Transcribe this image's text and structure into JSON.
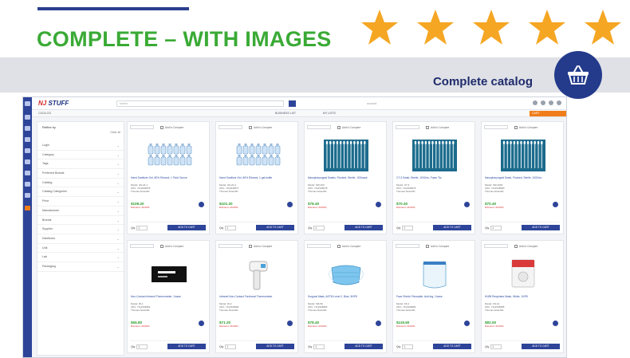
{
  "promo": {
    "headline": "COMPLETE – WITH IMAGES",
    "banner_text": "Complete catalog",
    "rating_stars": 5,
    "colors": {
      "headline": "#3aaa35",
      "star": "#f5a623",
      "accent": "#243b8c"
    },
    "icons": [
      "star-icon",
      "basket-icon"
    ]
  },
  "app": {
    "logo_text": "NJ",
    "logo_text_2": "STUFF",
    "search_placeholder": "search",
    "account_text": "account",
    "breadcrumb": "CATALOG",
    "subnav": [
      "BUSINESS LIST",
      "MY LISTS"
    ],
    "cart_label": "CART",
    "filters": {
      "title": "Refine by",
      "clear_label": "Clear all",
      "items": [
        "Login",
        "Category",
        "Tags",
        "Preferred Brands",
        "Catalog",
        "Catalog Categories",
        "Price",
        "Manufacturer",
        "Brands",
        "Supplier",
        "Distributor",
        "Unit",
        "Lab",
        "Packaging"
      ]
    },
    "card_labels": {
      "select": "Add to list",
      "compare": "Add to Compare",
      "qty": "Qty",
      "add_to_cart": "ADD TO CART"
    },
    "products": [
      {
        "image": "bottles",
        "name": "Hand Sanitizer Gel, 80% Ethanol, 1 Fluid Ounce",
        "meta1": "Model: HS-24-1",
        "meta2": "UPC: 7112345676",
        "meta3": "Thomas Scientific",
        "price": "$109.20",
        "discount": "Discount: 30.00%"
      },
      {
        "image": "bottles",
        "name": "Hand Sanitizer Gel, 80% Ethanol, 1 gal bottle",
        "meta1": "Model: HS-24-2",
        "meta2": "UPC: 7112345677",
        "meta3": "Thomas Scientific",
        "price": "$101.20",
        "discount": "Discount: 20.00%"
      },
      {
        "image": "swabs",
        "name": "Nasopharyngeal Swabs, Flocked, Sterile, 100/case",
        "meta1": "Model: SW-100",
        "meta2": "UPC: 7112345678",
        "meta3": "Thomas Scientific",
        "price": "$78.40",
        "discount": "Discount: 20.00%"
      },
      {
        "image": "swabs",
        "name": "CT-3 Swab, Sterile, 1000/cs, Foam Tip",
        "meta1": "Model: CT-3",
        "meta2": "UPC: 7112345679",
        "meta3": "Thomas Scientific",
        "price": "$70.40",
        "discount": "Discount: 20.00%"
      },
      {
        "image": "swabs",
        "name": "Nasopharyngeal Swab, Flocked, Sterile, 1000/cs",
        "meta1": "Model: SW-1000",
        "meta2": "UPC: 7112345680",
        "meta3": "Thomas Scientific",
        "price": "$70.40",
        "discount": "Discount: 20.00%"
      },
      {
        "image": "thermometer-display",
        "name": "Non-Contact Infrared Thermometer, 1/case",
        "meta1": "Model: IR-1",
        "meta2": "UPC: 7112345681",
        "meta3": "Thomas Scientific",
        "price": "$55.80",
        "discount": "Discount: 20.00%"
      },
      {
        "image": "thermometer",
        "name": "Infrared Non-Contact Forehead Thermometer",
        "meta1": "Model: IR-2",
        "meta2": "UPC: 7112345682",
        "meta3": "Thomas Scientific",
        "price": "$71.20",
        "discount": "Discount: 20.00%"
      },
      {
        "image": "mask",
        "name": "Surgical Mask, ASTM Level 2, Blue, 50/PK",
        "meta1": "Model: SM-50",
        "meta2": "UPC: 7112345683",
        "meta3": "Thomas Scientific",
        "price": "$78.40",
        "discount": "Discount: 20.00%"
      },
      {
        "image": "face-shield",
        "name": "Face Shield, Reusable, Anti-fog, 1/case",
        "meta1": "Model: FS-1",
        "meta2": "UPC: 7112345684",
        "meta3": "Thomas Scientific",
        "price": "$119.60",
        "discount": "Discount: 20.00%"
      },
      {
        "image": "kit",
        "name": "KN95 Respirator Mask, White, 10/PK",
        "meta1": "Model: KN-10",
        "meta2": "UPC: 7112345685",
        "meta3": "Thomas Scientific",
        "price": "$82.00",
        "discount": "Discount: 20.00%"
      }
    ]
  }
}
